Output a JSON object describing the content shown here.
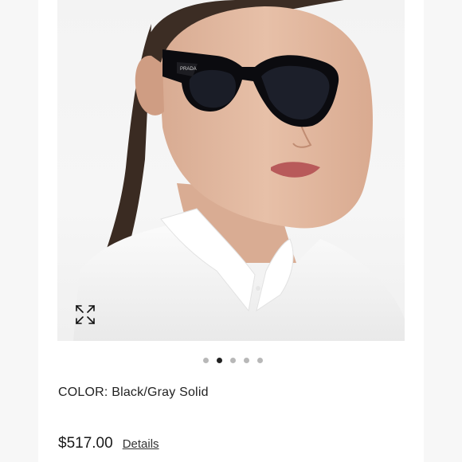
{
  "product": {
    "color_label": "COLOR:",
    "color_value": "Black/Gray Solid",
    "price": "$517.00",
    "details_link": "Details"
  },
  "gallery": {
    "image_count": 5,
    "active_index": 1,
    "expand_icon": "expand-arrows-icon"
  },
  "colors": {
    "background": "#f7f7f7",
    "panel": "#ffffff",
    "dot_active": "#222222",
    "dot_inactive": "#b8b8b8",
    "text": "#222222"
  }
}
